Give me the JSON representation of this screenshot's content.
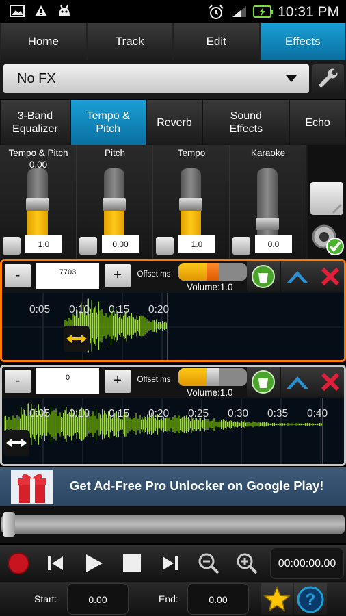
{
  "status_bar": {
    "time": "10:31 PM",
    "icons": [
      "gallery-icon",
      "warning-icon",
      "android-icon",
      "alarm-icon",
      "signal-icon",
      "battery-charging-icon"
    ]
  },
  "main_tabs": [
    {
      "label": "Home",
      "active": false
    },
    {
      "label": "Track",
      "active": false
    },
    {
      "label": "Edit",
      "active": false
    },
    {
      "label": "Effects",
      "active": true
    }
  ],
  "preset": {
    "selected": "No FX"
  },
  "effect_tabs": [
    {
      "label": "3-Band Equalizer",
      "active": false
    },
    {
      "label": "Tempo & Pitch",
      "active": true
    },
    {
      "label": "Reverb",
      "active": false
    },
    {
      "label": "Sound Effects",
      "active": false
    },
    {
      "label": "Echo",
      "active": false
    }
  ],
  "sliders": [
    {
      "label": "Tempo & Pitch",
      "value_text": "0.00",
      "input": "1.0",
      "level": 0.5
    },
    {
      "label": "Pitch",
      "value_text": "",
      "input": "0.00",
      "level": 0.5
    },
    {
      "label": "Tempo",
      "value_text": "",
      "input": "1.0",
      "level": 0.5
    },
    {
      "label": "Karaoke",
      "value_text": "",
      "input": "0.0",
      "level": 0.0
    }
  ],
  "tracks": [
    {
      "offset": "7703",
      "offset_label": "Offset ms",
      "volume_label": "Volume:1.0",
      "volume_level": 0.5,
      "selected": true,
      "ticks": [
        "0:05",
        "0:10",
        "0:15",
        "0:20"
      ]
    },
    {
      "offset": "0",
      "offset_label": "Offset ms",
      "volume_label": "Volume:1.0",
      "volume_level": 0.5,
      "selected": false,
      "ticks": [
        "0:05",
        "0:10",
        "0:15",
        "0:20",
        "0:25",
        "0:30",
        "0:35",
        "0:40"
      ]
    }
  ],
  "ad": {
    "text": "Get Ad-Free Pro Unlocker on Google Play!"
  },
  "seek": {
    "position": 0.0
  },
  "transport": {
    "time": "00:00:00.00"
  },
  "range": {
    "start_label": "Start:",
    "start_value": "0.00",
    "end_label": "End:",
    "end_value": "0.00"
  },
  "colors": {
    "accent": "#1a9fd6",
    "wave": "#9adf2a",
    "selected_track": "#ff7a00",
    "slider_fill": "#ffc81a"
  }
}
